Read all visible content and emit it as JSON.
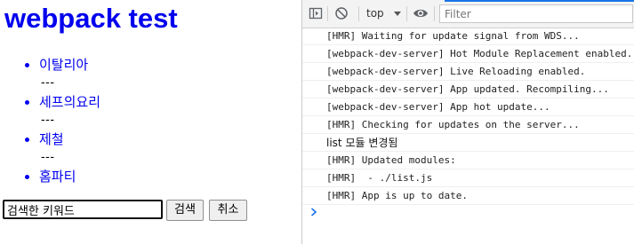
{
  "page": {
    "title": "webpack test",
    "menu": [
      {
        "label": "이탈리아",
        "sep": "---"
      },
      {
        "label": "세프의요리",
        "sep": "---"
      },
      {
        "label": "제철",
        "sep": "---"
      },
      {
        "label": "홈파티",
        "sep": ""
      }
    ],
    "search": {
      "value": "검색한 키워드",
      "placeholder": ""
    },
    "buttons": {
      "search": "검색",
      "cancel": "취소"
    },
    "colors": {
      "link": "#0000ee",
      "accent": "#1a73e8"
    }
  },
  "devtools": {
    "toolbar": {
      "sidebar_icon": "sidebar-toggle-icon",
      "clear_icon": "clear-console-icon",
      "context": "top",
      "eye_icon": "live-expression-eye-icon",
      "filter_placeholder": "Filter"
    },
    "console": [
      "[HMR] Waiting for update signal from WDS...",
      "[webpack-dev-server] Hot Module Replacement enabled.",
      "[webpack-dev-server] Live Reloading enabled.",
      "[webpack-dev-server] App updated. Recompiling...",
      "[webpack-dev-server] App hot update...",
      "[HMR] Checking for updates on the server...",
      "list 모듈 변경됨",
      "[HMR] Updated modules:",
      "[HMR]  - ./list.js",
      "[HMR] App is up to date."
    ],
    "prompt_icon": "console-prompt-chevron-icon"
  }
}
